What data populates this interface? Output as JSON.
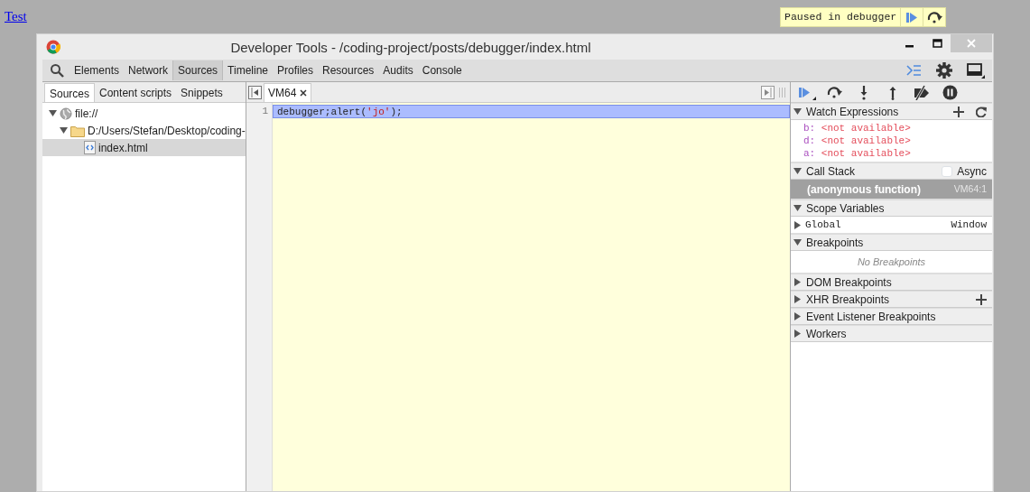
{
  "page_link": "Test",
  "paused_overlay": {
    "message": "Paused in debugger"
  },
  "window": {
    "title": "Developer Tools - /coding-project/posts/debugger/index.html"
  },
  "toolbar": {
    "tabs": [
      {
        "label": "Elements",
        "selected": false
      },
      {
        "label": "Network",
        "selected": false
      },
      {
        "label": "Sources",
        "selected": true
      },
      {
        "label": "Timeline",
        "selected": false
      },
      {
        "label": "Profiles",
        "selected": false
      },
      {
        "label": "Resources",
        "selected": false
      },
      {
        "label": "Audits",
        "selected": false
      },
      {
        "label": "Console",
        "selected": false
      }
    ]
  },
  "navigator": {
    "tabs": [
      {
        "label": "Sources",
        "selected": true
      },
      {
        "label": "Content scripts",
        "selected": false
      },
      {
        "label": "Snippets",
        "selected": false
      }
    ],
    "tree": [
      {
        "kind": "origin",
        "label": "file://",
        "expanded": true,
        "selected": false,
        "children": [
          {
            "kind": "folder",
            "label": "D:/Users/Stefan/Desktop/coding-",
            "expanded": true,
            "selected": false,
            "children": [
              {
                "kind": "file",
                "label": "index.html",
                "selected": true
              }
            ]
          }
        ]
      }
    ]
  },
  "editor": {
    "tabs": [
      {
        "label": "VM64",
        "selected": true
      }
    ],
    "lines": [
      {
        "number": "1",
        "highlighted": true,
        "tokens": [
          {
            "kind": "plain",
            "text": "debugger;alert("
          },
          {
            "kind": "string",
            "text": "'jo'"
          },
          {
            "kind": "plain",
            "text": ");"
          }
        ]
      }
    ]
  },
  "sidebar": {
    "sections": [
      {
        "kind": "watch",
        "title": "Watch Expressions",
        "expanded": true,
        "items": [
          {
            "name": "b:",
            "value": "<not available>"
          },
          {
            "name": "d:",
            "value": "<not available>"
          },
          {
            "name": "a:",
            "value": "<not available>"
          }
        ]
      },
      {
        "kind": "callstack",
        "title": "Call Stack",
        "expanded": true,
        "async_label": "Async",
        "async_checked": false,
        "frames": [
          {
            "name": "(anonymous function)",
            "location": "VM64:1",
            "selected": true
          }
        ]
      },
      {
        "kind": "scope",
        "title": "Scope Variables",
        "expanded": true,
        "items": [
          {
            "name": "Global",
            "value": "Window",
            "expanded": false
          }
        ]
      },
      {
        "kind": "breakpoints",
        "title": "Breakpoints",
        "expanded": true,
        "empty_text": "No Breakpoints"
      },
      {
        "kind": "plain",
        "title": "DOM Breakpoints",
        "expanded": false
      },
      {
        "kind": "plain",
        "title": "XHR Breakpoints",
        "expanded": false,
        "add_button": true
      },
      {
        "kind": "plain",
        "title": "Event Listener Breakpoints",
        "expanded": false
      },
      {
        "kind": "plain",
        "title": "Workers",
        "expanded": false
      }
    ]
  }
}
